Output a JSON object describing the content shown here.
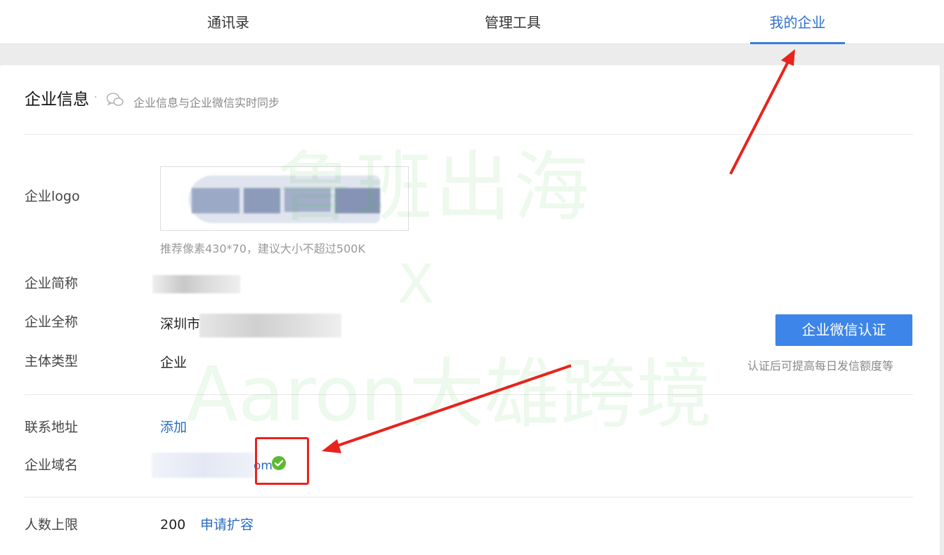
{
  "nav": {
    "tabs": [
      {
        "label": "通讯录"
      },
      {
        "label": "管理工具"
      },
      {
        "label": "我的企业",
        "active": true
      }
    ],
    "accent_color": "#3b7de0"
  },
  "section": {
    "title": "企业信息",
    "separator": "·",
    "sync_icon": "wechat-bubble-icon",
    "subtitle": "企业信息与企业微信实时同步"
  },
  "fields": {
    "logo": {
      "label": "企业logo",
      "hint": "推荐像素430*70，建议大小不超过500K"
    },
    "short_name": {
      "label": "企业简称"
    },
    "full_name": {
      "label": "企业全称",
      "value_prefix": "深圳市"
    },
    "entity_type": {
      "label": "主体类型",
      "value": "企业"
    },
    "address": {
      "label": "联系地址",
      "action": "添加"
    },
    "domain": {
      "label": "企业域名",
      "value_suffix": "om",
      "status_icon": "check-circle-icon"
    },
    "headcount": {
      "label": "人数上限",
      "value": "200",
      "action": "申请扩容"
    }
  },
  "verify": {
    "button_label": "企业微信认证",
    "note": "认证后可提高每日发信额度等",
    "button_color": "#3d85e8"
  },
  "watermark": {
    "line1": "鲁班出海",
    "line2": "X",
    "line3": "Aaron大雄跨境"
  },
  "annotation_color": "#e8231c"
}
